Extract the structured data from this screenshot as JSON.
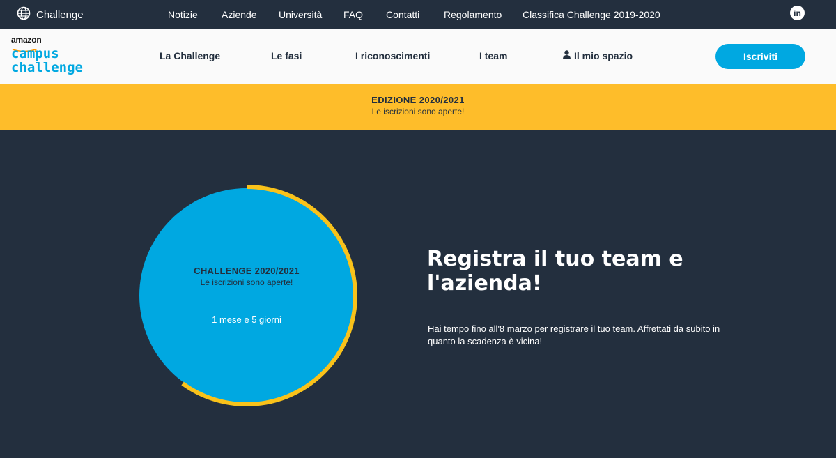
{
  "topbar": {
    "language_label": "Challenge",
    "language_icon": "globe-icon",
    "links": [
      "Notizie",
      "Aziende",
      "Università",
      "FAQ",
      "Contatti",
      "Regolamento",
      "Classifica Challenge 2019-2020"
    ],
    "social_icon": "linkedin-icon",
    "social_label": "in"
  },
  "logo": {
    "brand": "amazon",
    "line1": "campus",
    "line2": "challenge"
  },
  "nav": {
    "items": [
      "La Challenge",
      "Le fasi",
      "I riconoscimenti",
      "I team"
    ],
    "my_space": "Il mio spazio",
    "my_space_icon": "user-icon",
    "cta": "Iscriviti"
  },
  "banner": {
    "title": "EDIZIONE 2020/2021",
    "subtitle": "Le iscrizioni sono aperte!"
  },
  "countdown": {
    "title": "CHALLENGE 2020/2021",
    "subtitle": "Le iscrizioni sono aperte!",
    "remaining": "1 mese e 5 giorni",
    "progress_fraction": 0.6
  },
  "hero": {
    "headline": "Registra il tuo team e l'azienda!",
    "description": "Hai tempo fino all'8 marzo per registrare il tuo team. Affrettati da subito in quanto la scadenza è vicina!"
  },
  "colors": {
    "dark": "#232f3e",
    "accent_blue": "#00a8e1",
    "accent_yellow": "#febd2a",
    "ring_yellow": "#f9c21a"
  }
}
